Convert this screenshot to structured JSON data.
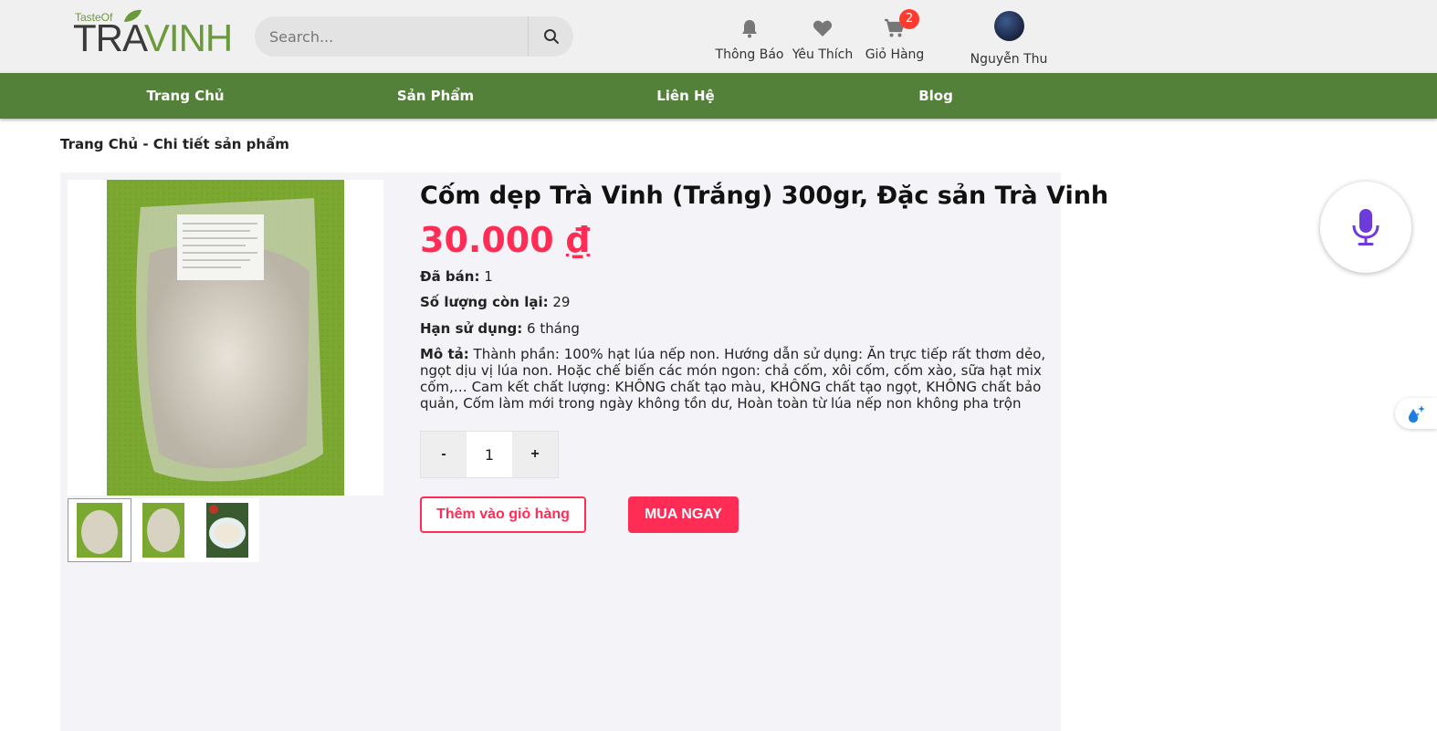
{
  "brand": {
    "logo_small": "TasteOf",
    "logo_main_part1": "TRA",
    "logo_main_part2": "VINH"
  },
  "search": {
    "placeholder": "Search..."
  },
  "header_icons": [
    {
      "label": "Thông Báo",
      "icon": "bell-icon"
    },
    {
      "label": "Yêu Thích",
      "icon": "heart-icon"
    },
    {
      "label": "Giỏ Hàng",
      "icon": "cart-icon",
      "badge": "2"
    }
  ],
  "user": {
    "name": "Nguyễn Thu"
  },
  "nav": [
    {
      "label": "Trang Chủ"
    },
    {
      "label": "Sản Phẩm"
    },
    {
      "label": "Liên Hệ"
    },
    {
      "label": "Blog"
    }
  ],
  "breadcrumb": "Trang Chủ - Chi tiết sản phẩm",
  "product": {
    "title": "Cốm dẹp Trà Vinh (Trắng) 300gr, Đặc sản Trà Vinh",
    "price": "30.000",
    "currency": "₫",
    "sold_label": "Đã bán:",
    "sold": "1",
    "remaining_label": "Số lượng còn lại:",
    "remaining": "29",
    "expiry_label": "Hạn sử dụng:",
    "expiry": "6 tháng",
    "desc_label": "Mô tả:",
    "description": "Thành phần: 100% hạt lúa nếp non. Hướng dẫn sử dụng: Ăn trực tiếp rất thơm dẻo, ngọt dịu vị lúa non. Hoặc chế biến các món ngon: chả cốm, xôi cốm, cốm xào, sữa hạt mix cốm,… Cam kết chất lượng: KHÔNG chất tạo màu, KHÔNG chất tạo ngọt, KHÔNG chất bảo quản, Cốm làm mới trong ngày không tồn dư, Hoàn toàn từ lúa nếp non không pha trộn"
  },
  "quantity": {
    "minus": "-",
    "value": "1",
    "plus": "+"
  },
  "actions": {
    "add_to_cart": "Thêm vào giỏ hàng",
    "buy_now": "MUA NGAY"
  },
  "colors": {
    "nav_green": "#548139",
    "accent_red": "#ff2d55",
    "mic_purple": "#6c3bd9"
  }
}
